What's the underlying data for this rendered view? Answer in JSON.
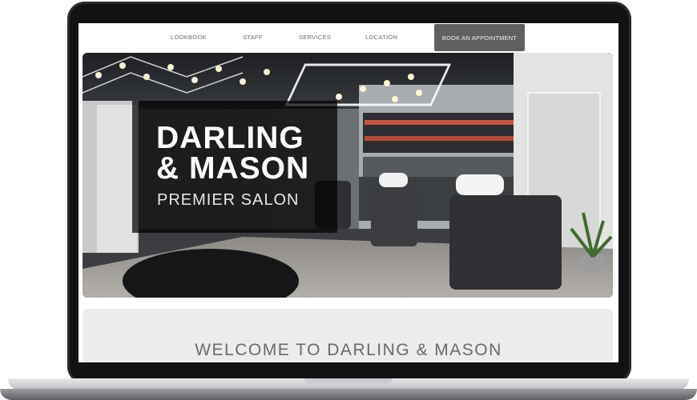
{
  "nav": {
    "links": [
      "LOOKBOOK",
      "STAFF",
      "SERVICES",
      "LOCATION"
    ],
    "cta": "BOOK AN APPOINTMENT"
  },
  "hero": {
    "title": "DARLING\n& MASON",
    "subtitle": "PREMIER SALON"
  },
  "welcome": {
    "title": "WELCOME TO DARLING & MASON"
  },
  "colors": {
    "nav_cta_bg": "#5f6062",
    "nav_text": "#666a6f",
    "overlay": "#000000",
    "welcome_bg": "#ececec"
  }
}
